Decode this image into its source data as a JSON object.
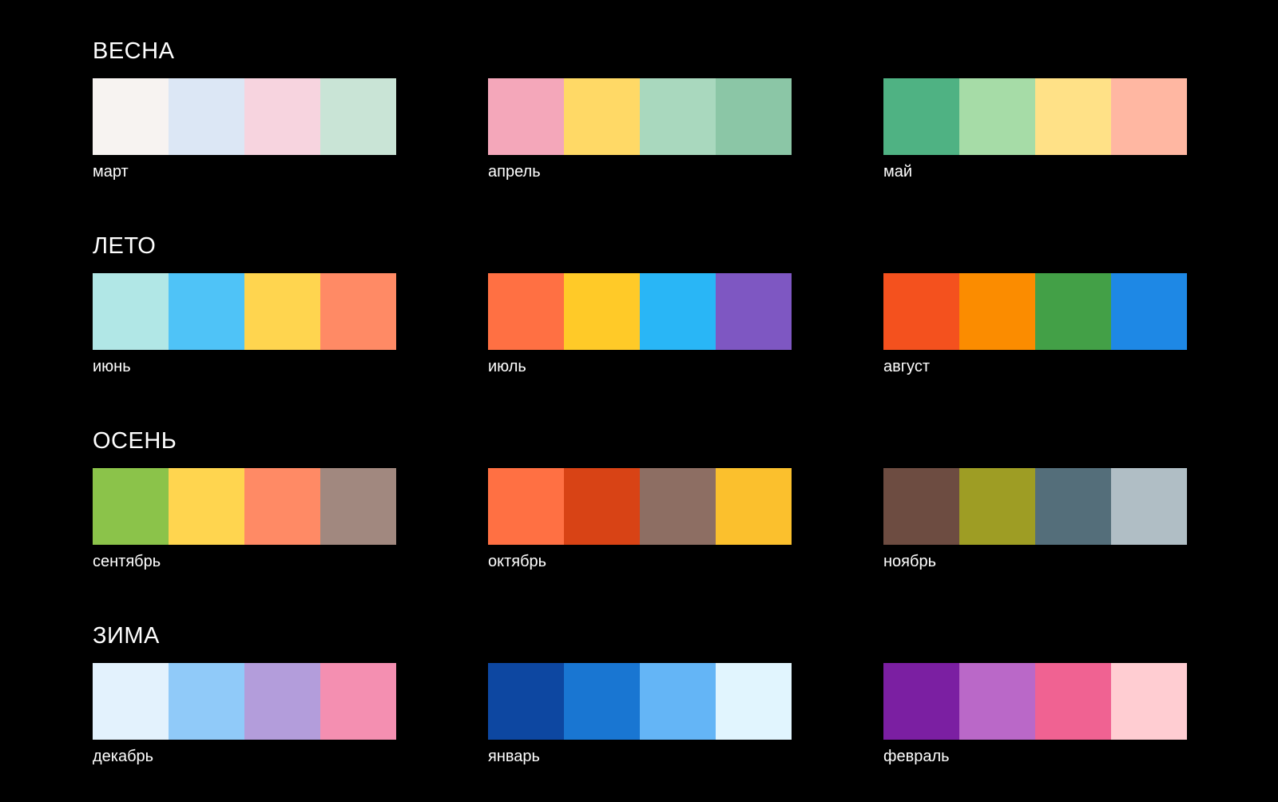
{
  "seasons": [
    {
      "title": "ВЕСНА",
      "palettes": [
        {
          "label": "март",
          "colors": [
            "#F7F3F1",
            "#DCE7F5",
            "#F7D4DF",
            "#C9E4D6"
          ]
        },
        {
          "label": "апрель",
          "colors": [
            "#F4A7BA",
            "#FFD966",
            "#A9D8BE",
            "#8BC6A6"
          ]
        },
        {
          "label": "май",
          "colors": [
            "#4FB283",
            "#A6DCA7",
            "#FFE187",
            "#FFB7A2"
          ]
        }
      ]
    },
    {
      "title": "ЛЕТО",
      "palettes": [
        {
          "label": "июнь",
          "colors": [
            "#B1E7E6",
            "#4FC3F7",
            "#FFD54F",
            "#FF8A65"
          ]
        },
        {
          "label": "июль",
          "colors": [
            "#FF7043",
            "#FFCA28",
            "#29B6F6",
            "#7E57C2"
          ]
        },
        {
          "label": "август",
          "colors": [
            "#F4511E",
            "#FB8C00",
            "#43A047",
            "#1E88E5"
          ]
        }
      ]
    },
    {
      "title": "ОСЕНЬ",
      "palettes": [
        {
          "label": "сентябрь",
          "colors": [
            "#8BC34A",
            "#FFD54F",
            "#FF8A65",
            "#A1887F"
          ]
        },
        {
          "label": "октябрь",
          "colors": [
            "#FF7043",
            "#D84315",
            "#8D6E63",
            "#FBC02D"
          ]
        },
        {
          "label": "ноябрь",
          "colors": [
            "#6D4C41",
            "#9E9D24",
            "#546E7A",
            "#B0BEC5"
          ]
        }
      ]
    },
    {
      "title": "ЗИМА",
      "palettes": [
        {
          "label": "декабрь",
          "colors": [
            "#E3F2FD",
            "#90CAF9",
            "#B39DDB",
            "#F48FB1"
          ]
        },
        {
          "label": "январь",
          "colors": [
            "#0D47A1",
            "#1976D2",
            "#64B5F6",
            "#E1F5FE"
          ]
        },
        {
          "label": "февраль",
          "colors": [
            "#7B1FA2",
            "#BA68C8",
            "#F06292",
            "#FFCDD2"
          ]
        }
      ]
    }
  ]
}
